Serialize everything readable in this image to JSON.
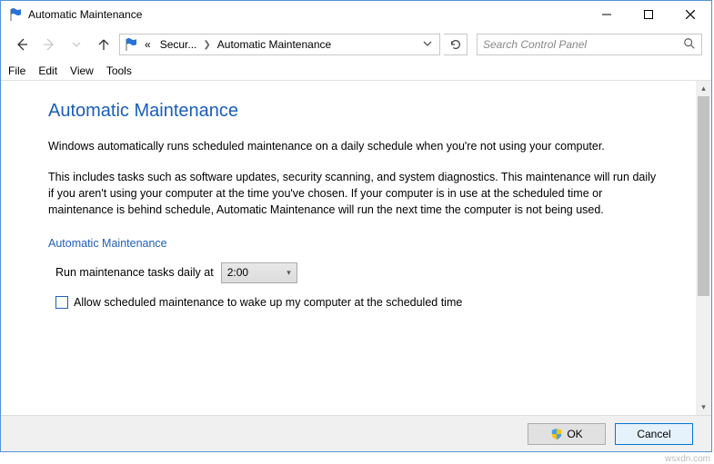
{
  "window": {
    "title": "Automatic Maintenance"
  },
  "nav": {
    "breadcrumb_prefix": "«",
    "crumb1": "Secur...",
    "crumb2": "Automatic Maintenance"
  },
  "search": {
    "placeholder": "Search Control Panel"
  },
  "menu": {
    "file": "File",
    "edit": "Edit",
    "view": "View",
    "tools": "Tools"
  },
  "content": {
    "heading": "Automatic Maintenance",
    "p1": "Windows automatically runs scheduled maintenance on a daily schedule when you're not using your computer.",
    "p2": "This includes tasks such as software updates, security scanning, and system diagnostics. This maintenance will run daily if you aren't using your computer at the time you've chosen. If your computer is in use at the scheduled time or maintenance is behind schedule, Automatic Maintenance will run the next time the computer is not being used.",
    "subheading": "Automatic Maintenance",
    "time_label": "Run maintenance tasks daily at",
    "time_value": "2:00",
    "wake_label": "Allow scheduled maintenance to wake up my computer at the scheduled time"
  },
  "footer": {
    "ok": "OK",
    "cancel": "Cancel"
  },
  "attribution": "wsxdn.com"
}
